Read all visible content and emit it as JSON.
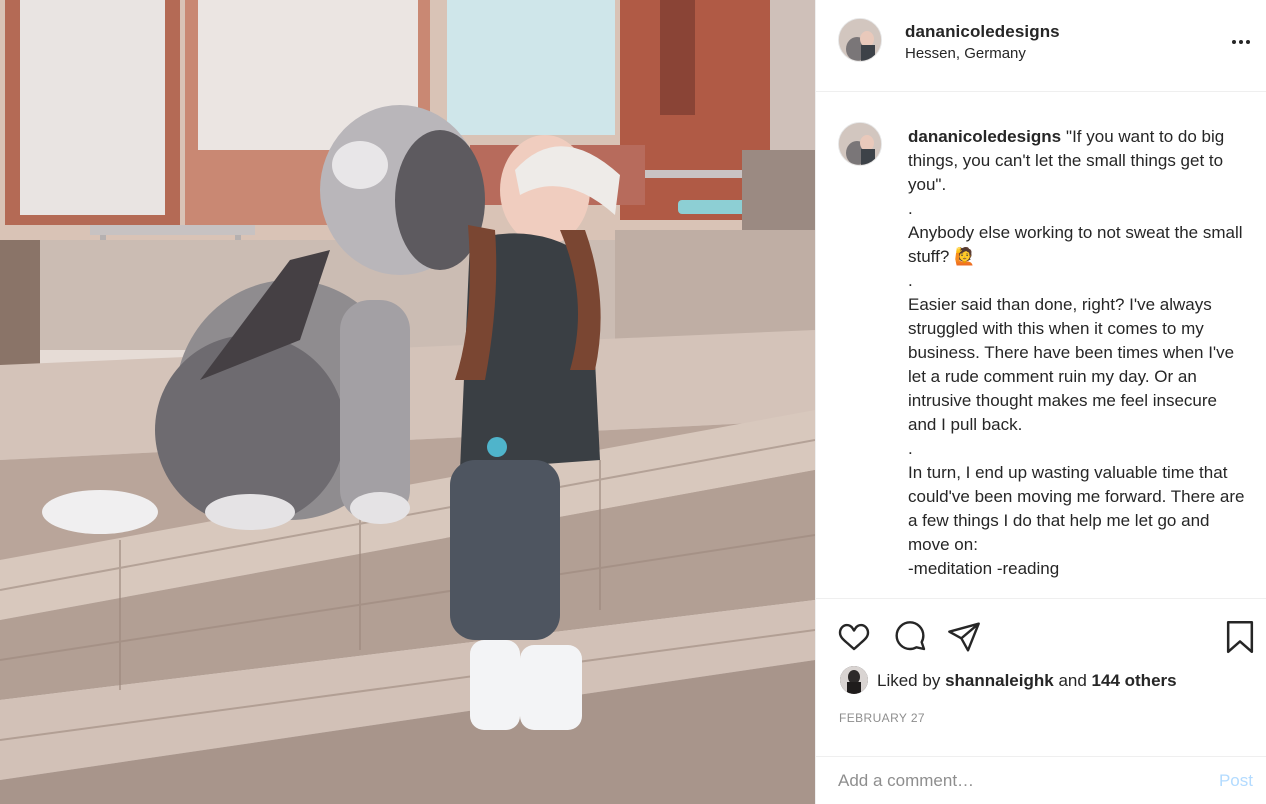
{
  "post": {
    "username": "dananicoledesigns",
    "location": "Hessen, Germany",
    "more_icon": "more-horizontal-icon"
  },
  "caption": {
    "username": "dananicoledesigns",
    "text": "\"If you want to do big things, you can't let the small things get to you\".\n.\nAnybody else working to not sweat the small stuff? 🙋\n.\nEasier said than done, right? I've always struggled with this when it comes to my business. There have been times when I've let a rude comment ruin my day. Or an intrusive thought makes me feel insecure and I pull back.\n.\nIn turn, I end up wasting valuable time that could've been moving me forward. There are a few things I do that help me let go and move on:\n-meditation -reading"
  },
  "actions": {
    "like_icon": "heart-icon",
    "comment_icon": "comment-icon",
    "share_icon": "share-icon",
    "save_icon": "bookmark-icon"
  },
  "likes": {
    "prefix": "Liked by",
    "user": "shannaleighk",
    "middle": "and",
    "others": "144 others"
  },
  "date": "FEBRUARY 27",
  "comment": {
    "placeholder": "Add a comment…",
    "post_label": "Post",
    "post_color": "#b3dbff"
  },
  "colors": {
    "text": "#262626",
    "muted": "#8e8e8e",
    "border": "#efefef"
  }
}
